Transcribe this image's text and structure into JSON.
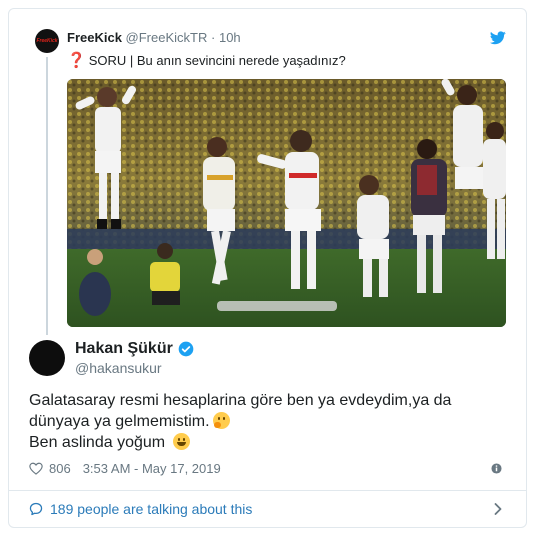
{
  "quoted_tweet": {
    "avatar_text": "FreeKick",
    "name": "FreeKick",
    "handle": "@FreeKickTR",
    "separator": "·",
    "time": "10h",
    "text": "SORU | Bu anın sevincini nerede yaşadınız?",
    "question_mark": "❓"
  },
  "tweet": {
    "author_name": "Hakan Şükür",
    "author_handle": "@hakansukur",
    "line1": "Galatasaray resmi hesaplarina göre ben ya evdeydim,ya da",
    "line2": "dünyaya ya gelmemistim.",
    "line3": "Ben aslinda yoğum",
    "like_count": "806",
    "timestamp": "3:53 AM - May 17, 2019"
  },
  "footer": {
    "talking_label": "189 people are talking about this"
  },
  "colors": {
    "link_blue": "#2b7bb9",
    "twitter_blue": "#1da1f2",
    "muted_text": "#697882",
    "border": "#e1e8ed",
    "question_red": "#dd2e44"
  },
  "icons": [
    "twitter-bird-icon",
    "verified-badge-icon",
    "heart-icon",
    "info-icon",
    "comment-icon",
    "chevron-right-icon",
    "thinking-face-emoji",
    "grinning-face-emoji"
  ]
}
